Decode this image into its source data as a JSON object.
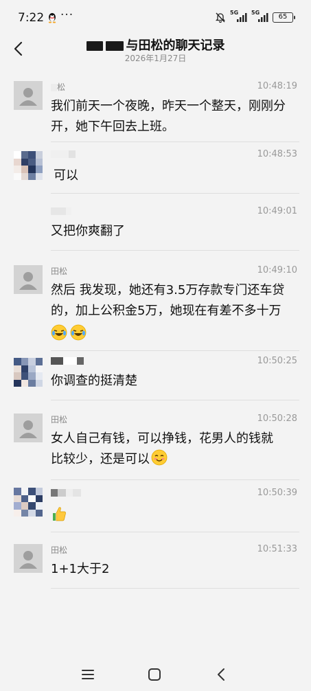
{
  "status_bar": {
    "time": "7:22",
    "signal1_label": "5G",
    "signal2_label": "5G",
    "battery": "65"
  },
  "header": {
    "title": "与田松的聊天记录",
    "date": "2026年1月27日"
  },
  "messages": [
    {
      "sender": "松",
      "time": "10:48:19",
      "text": "我们前天一个夜晚，昨天一个整天，刚刚分开，她下午回去上班。",
      "avatar": "default"
    },
    {
      "sender": "",
      "time": "10:48:53",
      "text": "可以",
      "avatar": "mosaic"
    },
    {
      "sender": "",
      "time": "10:49:01",
      "text": "又把你爽翻了",
      "avatar": "none"
    },
    {
      "sender": "田松",
      "time": "10:49:10",
      "text": "然后 我发现，她还有3.5万存款专门还车贷的，加上公积金5万，她现在有差不多十万",
      "avatar": "default",
      "emojis": [
        "laughing-crying-emoji",
        "laughing-crying-emoji"
      ]
    },
    {
      "sender": "",
      "time": "10:50:25",
      "text": "你调查的挺清楚",
      "avatar": "mosaic"
    },
    {
      "sender": "田松",
      "time": "10:50:28",
      "text": "女人自己有钱，可以挣钱，花男人的钱就比较少，还是可以",
      "avatar": "default",
      "emojis": [
        "blushing-smile-emoji"
      ]
    },
    {
      "sender": "",
      "time": "10:50:39",
      "text": "",
      "avatar": "mosaic",
      "emojis": [
        "thumbs-up-emoji"
      ]
    },
    {
      "sender": "田松",
      "time": "10:51:33",
      "text": "1+1大于2",
      "avatar": "default"
    }
  ],
  "icons": {
    "back": "chevron-left-icon",
    "mute": "bell-off-icon",
    "menu": "menu-icon",
    "home": "home-square-icon",
    "back_nav": "back-triangle-icon"
  },
  "colors": {
    "background": "#f3f3f3",
    "divider": "#dedede",
    "meta_text": "#999999"
  }
}
